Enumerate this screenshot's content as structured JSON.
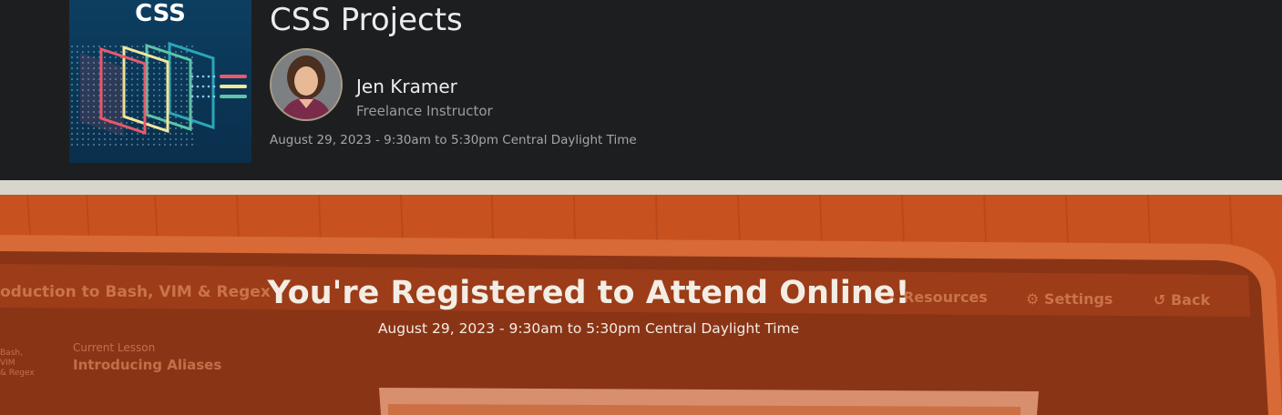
{
  "course": {
    "thumbnail_label": "CSS",
    "title": "CSS Projects",
    "date": "August 29, 2023 - 9:30am to 5:30pm Central Daylight Time"
  },
  "instructor": {
    "name": "Jen Kramer",
    "role": "Freelance Instructor"
  },
  "hero": {
    "title": "You're Registered to Attend Online!",
    "date": "August 29, 2023 - 9:30am to 5:30pm Central Daylight Time"
  },
  "colors": {
    "header_background": "#1d1e20",
    "hero_tint": "#cf5a24",
    "text_light": "#ececec",
    "text_muted": "#9c9c9c"
  }
}
